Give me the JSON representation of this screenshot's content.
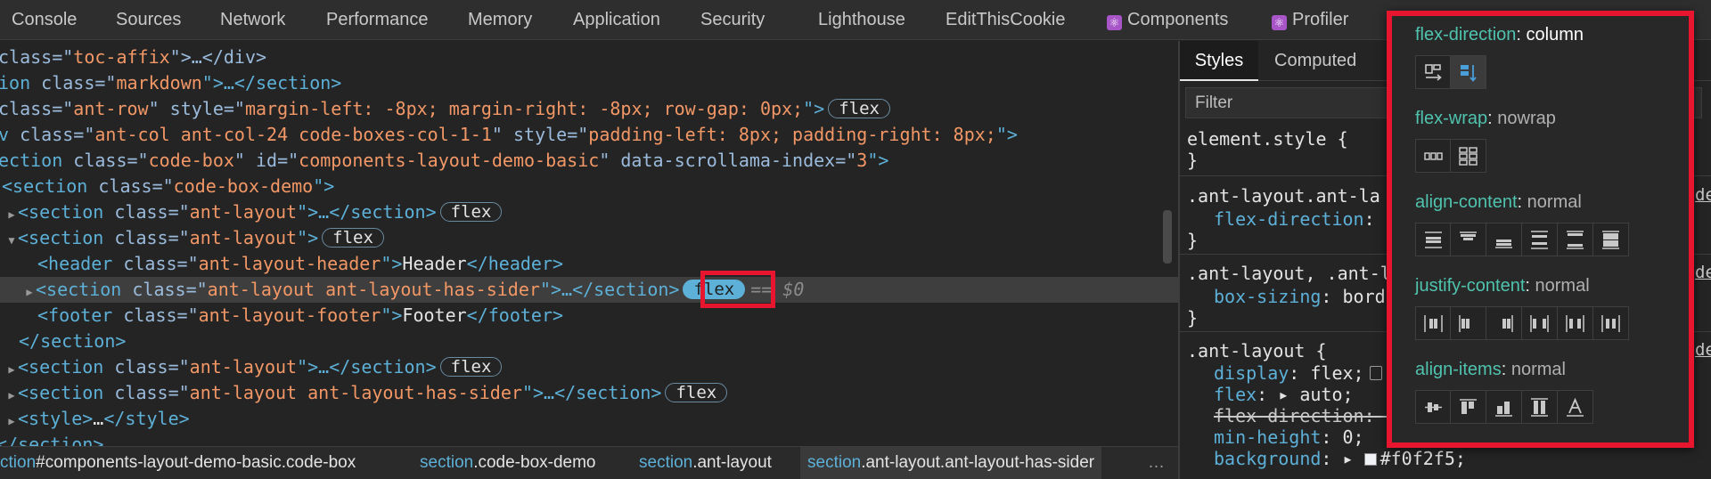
{
  "tabs": [
    {
      "label": "Console"
    },
    {
      "label": "Sources"
    },
    {
      "label": "Network"
    },
    {
      "label": "Performance"
    },
    {
      "label": "Memory"
    },
    {
      "label": "Application"
    },
    {
      "label": "Security"
    },
    {
      "label": "Lighthouse"
    },
    {
      "label": "EditThisCookie"
    },
    {
      "label": "Components",
      "icon": "react-icon"
    },
    {
      "label": "Profiler",
      "icon": "react-icon"
    }
  ],
  "elements": {
    "lines": [
      {
        "pre": "class=\"",
        "val": "toc-affix",
        "post": "\">…</div>"
      },
      {
        "name": "ion",
        "cls_attr": " class=\"",
        "val": "markdown",
        "post": "\">…</section>"
      },
      {
        "a1": "class=\"",
        "v1": "ant-row",
        "a2": "\" style=\"",
        "v2": "margin-left: -8px; margin-right: -8px; row-gap: 0px;",
        "post": "\">",
        "badge": "flex"
      },
      {
        "tag": "v",
        "a1": " class=\"",
        "v1": "ant-col ant-col-24 code-boxes-col-1-1",
        "a2": "\" style=\"",
        "v2": "padding-left: 8px; padding-right: 8px;",
        "post": "\">"
      },
      {
        "tag": "ection",
        "a1": " class=\"",
        "v1": "code-box",
        "a2": "\" id=\"",
        "v2": "components-layout-demo-basic",
        "a3": "\" data-scrollama-index=\"",
        "v3": "3",
        "post": "\">"
      },
      {
        "tag": "<section",
        "a1": " class=\"",
        "v1": "code-box-demo",
        "post": "\">"
      },
      {
        "tag": "<section",
        "a1": " class=\"",
        "v1": "ant-layout",
        "mid": "\">…",
        "close": "</section>",
        "badge": "flex"
      },
      {
        "tag": "<section",
        "a1": " class=\"",
        "v1": "ant-layout",
        "post": "\">",
        "badge": "flex"
      },
      {
        "tag": "<header",
        "a1": " class=\"",
        "v1": "ant-layout-header",
        "mid": "\">",
        "text": "Header",
        "close": "</header>"
      },
      {
        "tag": "<section",
        "a1": " class=\"",
        "v1": "ant-layout ant-layout-has-sider",
        "mid": "\">…",
        "close": "</section>",
        "badge": "flex",
        "selected": "== $0"
      },
      {
        "tag": "<footer",
        "a1": " class=\"",
        "v1": "ant-layout-footer",
        "mid": "\">",
        "text": "Footer",
        "close": "</footer>"
      },
      {
        "close": "</section>"
      },
      {
        "tag": "<section",
        "a1": " class=\"",
        "v1": "ant-layout",
        "mid": "\">…",
        "close": "</section>",
        "badge": "flex"
      },
      {
        "tag": "<section",
        "a1": " class=\"",
        "v1": "ant-layout ant-layout-has-sider",
        "mid": "\">…",
        "close": "</section>",
        "badge": "flex"
      },
      {
        "tag": "<style>",
        "mid": "…",
        "close": "</style>"
      },
      {
        "close": "</section>"
      }
    ]
  },
  "breadcrumb": [
    {
      "tag": "ction",
      "cls": "#components-layout-demo-basic.code-box"
    },
    {
      "tag": "section",
      "cls": ".code-box-demo"
    },
    {
      "tag": "section",
      "cls": ".ant-layout"
    },
    {
      "tag": "section",
      "cls": ".ant-layout.ant-layout-has-sider"
    }
  ],
  "breadcrumb_more": "…",
  "styles": {
    "subtabs": [
      "Styles",
      "Computed"
    ],
    "filter_placeholder": "Filter",
    "rules": [
      {
        "selector": "element.style {",
        "close": "}"
      },
      {
        "selector": ".ant-layout.ant-la",
        "prop": "flex-direction",
        "close": "}",
        "src": "de"
      },
      {
        "selector": ".ant-layout, .ant-l",
        "prop": "box-sizing",
        "val": ": bord",
        "close": "}",
        "src": "de"
      },
      {
        "selector": ".ant-layout {",
        "src": "de",
        "props": [
          {
            "name": "display",
            "val": ": flex;"
          },
          {
            "name": "flex",
            "val": ": ▸ auto;"
          },
          {
            "name": "flex-direction",
            "val": ": c",
            "struck": true
          },
          {
            "name": "min-height",
            "val": ": 0;"
          },
          {
            "name": "background",
            "val": ": ▸ ",
            "color": "#f0f2f5",
            "color_text": "#f0f2f5;"
          }
        ]
      }
    ]
  },
  "flex_editor": {
    "sections": [
      {
        "name": "flex-direction",
        "value": "column",
        "value_set": true,
        "icons": [
          "flex-direction-row-icon",
          "flex-direction-column-icon"
        ],
        "selected": 1
      },
      {
        "name": "flex-wrap",
        "value": "nowrap",
        "value_set": false,
        "icons": [
          "flex-wrap-nowrap-icon",
          "flex-wrap-wrap-icon"
        ],
        "selected": -1
      },
      {
        "name": "align-content",
        "value": "normal",
        "value_set": false,
        "icons": [
          "align-content-center-icon",
          "align-content-flex-start-icon",
          "align-content-flex-end-icon",
          "align-content-space-around-icon",
          "align-content-space-between-icon",
          "align-content-stretch-icon"
        ],
        "selected": -1
      },
      {
        "name": "justify-content",
        "value": "normal",
        "value_set": false,
        "icons": [
          "justify-content-center-icon",
          "justify-content-flex-start-icon",
          "justify-content-flex-end-icon",
          "justify-content-space-between-icon",
          "justify-content-space-around-icon",
          "justify-content-space-evenly-icon"
        ],
        "selected": -1
      },
      {
        "name": "align-items",
        "value": "normal",
        "value_set": false,
        "icons": [
          "align-items-center-icon",
          "align-items-flex-start-icon",
          "align-items-flex-end-icon",
          "align-items-stretch-icon",
          "align-items-baseline-icon"
        ],
        "selected": -1
      }
    ]
  }
}
